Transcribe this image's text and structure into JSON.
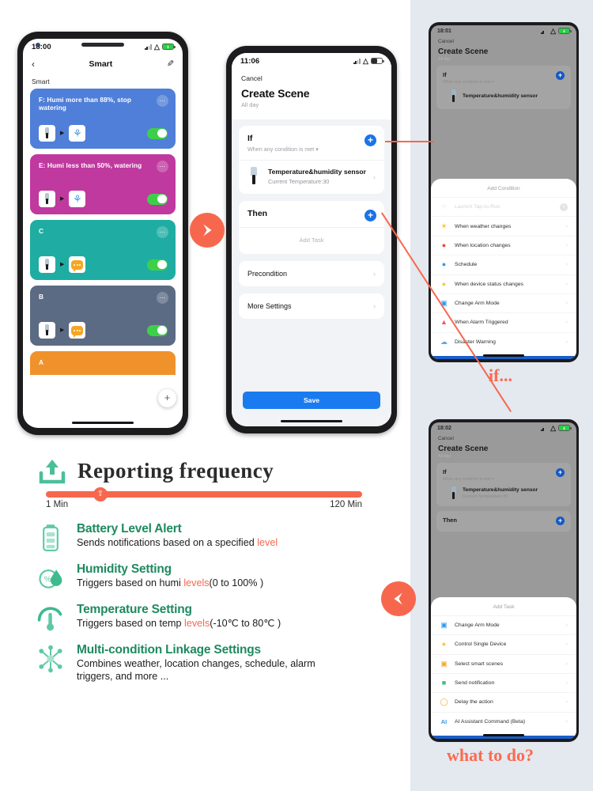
{
  "phone_smart": {
    "status": {
      "time": "18:00",
      "battery_icon": "battery-charging-green",
      "wifi_icon": "wifi-icon",
      "signal_icon": "signal-icon"
    },
    "nav": {
      "back_icon": "chevron-left-icon",
      "title": "Smart",
      "edit_icon": "pencil-icon"
    },
    "section_label": "Smart",
    "cards": [
      {
        "title": "F: Humi more than 88%, stop watering",
        "color": "#4f7fd8",
        "device_icon": "temp-humidity-sensor-icon",
        "action_icon": "water-valve-icon",
        "toggle": "on",
        "menu_icon": "more-dots-icon"
      },
      {
        "title": "E: Humi less than 50%, watering",
        "color": "#c0399f",
        "device_icon": "temp-humidity-sensor-icon",
        "action_icon": "water-valve-icon",
        "toggle": "on",
        "menu_icon": "more-dots-icon"
      },
      {
        "title": "C",
        "color": "#1fada3",
        "device_icon": "temp-humidity-sensor-icon",
        "action_icon": "notification-icon",
        "toggle": "on",
        "menu_icon": "more-dots-icon"
      },
      {
        "title": "B",
        "color": "#5c6b84",
        "device_icon": "temp-humidity-sensor-icon",
        "action_icon": "notification-icon",
        "toggle": "on",
        "menu_icon": "more-dots-icon"
      },
      {
        "title": "A",
        "color": "#f0922c",
        "device_icon": "temp-humidity-sensor-icon",
        "action_icon": "notification-icon",
        "toggle": "on",
        "menu_icon": "more-dots-icon"
      }
    ],
    "fab_label": "+"
  },
  "phone_scene": {
    "status": {
      "time": "11:06",
      "battery_icon": "battery-icon",
      "wifi_icon": "wifi-icon",
      "signal_icon": "signal-icon"
    },
    "cancel": "Cancel",
    "title": "Create Scene",
    "subtitle": "All day",
    "if_section": {
      "label": "If",
      "hint": "When any condition is met",
      "add_icon": "plus-circle-icon"
    },
    "condition": {
      "name": "Temperature&humidity sensor",
      "detail": "Current Temperature:30",
      "chevron": "›"
    },
    "then_section": {
      "label": "Then",
      "add_icon": "plus-circle-icon"
    },
    "add_task": "Add Task",
    "rows": [
      {
        "label": "Precondition",
        "chevron": "›"
      },
      {
        "label": "More Settings",
        "chevron": "›"
      }
    ],
    "save": "Save"
  },
  "phone_condition": {
    "status": {
      "time": "18:01"
    },
    "cancel": "Cancel",
    "title": "Create Scene",
    "subtitle": "All day",
    "if_section": {
      "label": "If",
      "hint": "When any condition is met"
    },
    "condition": {
      "name": "Temperature&humidity sensor"
    },
    "sheet_title": "Add Condition",
    "sheet_items": [
      {
        "label": "Launch Tap-to-Run",
        "icon": "tap-to-run-icon",
        "color": "#cfe9dd",
        "disabled": true
      },
      {
        "label": "When weather changes",
        "icon": "sun-icon",
        "color": "#ffb400"
      },
      {
        "label": "When location changes",
        "icon": "location-pin-icon",
        "color": "#f04438"
      },
      {
        "label": "Schedule",
        "icon": "clock-icon",
        "color": "#2e9bf0"
      },
      {
        "label": "When device status changes",
        "icon": "bulb-icon",
        "color": "#ffc53d"
      },
      {
        "label": "Change Arm Mode",
        "icon": "shield-check-icon",
        "color": "#2e9bf0"
      },
      {
        "label": "When Alarm Triggered",
        "icon": "bell-alarm-icon",
        "color": "#f4546a"
      },
      {
        "label": "Disaster Warning",
        "icon": "cloud-warning-icon",
        "color": "#5aa9ef"
      }
    ]
  },
  "phone_task": {
    "status": {
      "time": "18:02"
    },
    "cancel": "Cancel",
    "title": "Create Scene",
    "subtitle": "All day",
    "if_section": {
      "label": "If",
      "hint": "When any condition is met"
    },
    "condition": {
      "name": "Temperature&humidity sensor",
      "detail": "Current Temperature:30"
    },
    "then_section": {
      "label": "Then"
    },
    "sheet_title": "Add Task",
    "sheet_items": [
      {
        "label": "Change Arm Mode",
        "icon": "shield-check-icon",
        "color": "#2e9bf0"
      },
      {
        "label": "Control Single Device",
        "icon": "bulb-icon",
        "color": "#ffc53d"
      },
      {
        "label": "Select smart scenes",
        "icon": "scene-check-icon",
        "color": "#f7a823"
      },
      {
        "label": "Send notification",
        "icon": "mail-icon",
        "color": "#3fbf7f"
      },
      {
        "label": "Delay the action",
        "icon": "delay-clock-icon",
        "color": "#f7a823"
      },
      {
        "label": "AI Assistant Command (Beta)",
        "icon": "ai-icon",
        "color": "#2e9bf0"
      }
    ]
  },
  "captions": {
    "if": "if...",
    "what_to_do": "what to do?"
  },
  "arrows": {
    "right_icon": "arrow-right-circle-icon",
    "left_icon": "arrow-left-circle-icon"
  },
  "reporting": {
    "icon": "upload-icon",
    "title": "Reporting  frequency",
    "min_label": "1 Min",
    "max_label": "120 Min",
    "knob_icon": "upload-small-icon",
    "value_percent": 15
  },
  "features": [
    {
      "icon": "battery-level-icon",
      "title": "Battery Level Alert",
      "desc_before": "Sends notifications based on a specified ",
      "desc_highlight": "level",
      "desc_after": ""
    },
    {
      "icon": "humidity-percent-icon",
      "title": "Humidity Setting",
      "desc_before": "Triggers based on humi ",
      "desc_highlight": "levels",
      "desc_after": "(0  to 100% )"
    },
    {
      "icon": "thermometer-gauge-icon",
      "title": "Temperature Setting",
      "desc_before": "Triggers based on temp ",
      "desc_highlight": "levels",
      "desc_after": "(-10℃  to 80℃ )"
    },
    {
      "icon": "multi-node-linkage-icon",
      "title": "Multi-condition Linkage Settings",
      "desc_before": "Combines weather, location changes, schedule, alarm triggers, and more ...",
      "desc_highlight": "",
      "desc_after": ""
    }
  ],
  "colors": {
    "accent_orange": "#f7674e",
    "accent_green": "#1e8a5f",
    "accent_blue": "#1a73e8",
    "panel_grey": "#e4e8ef"
  }
}
